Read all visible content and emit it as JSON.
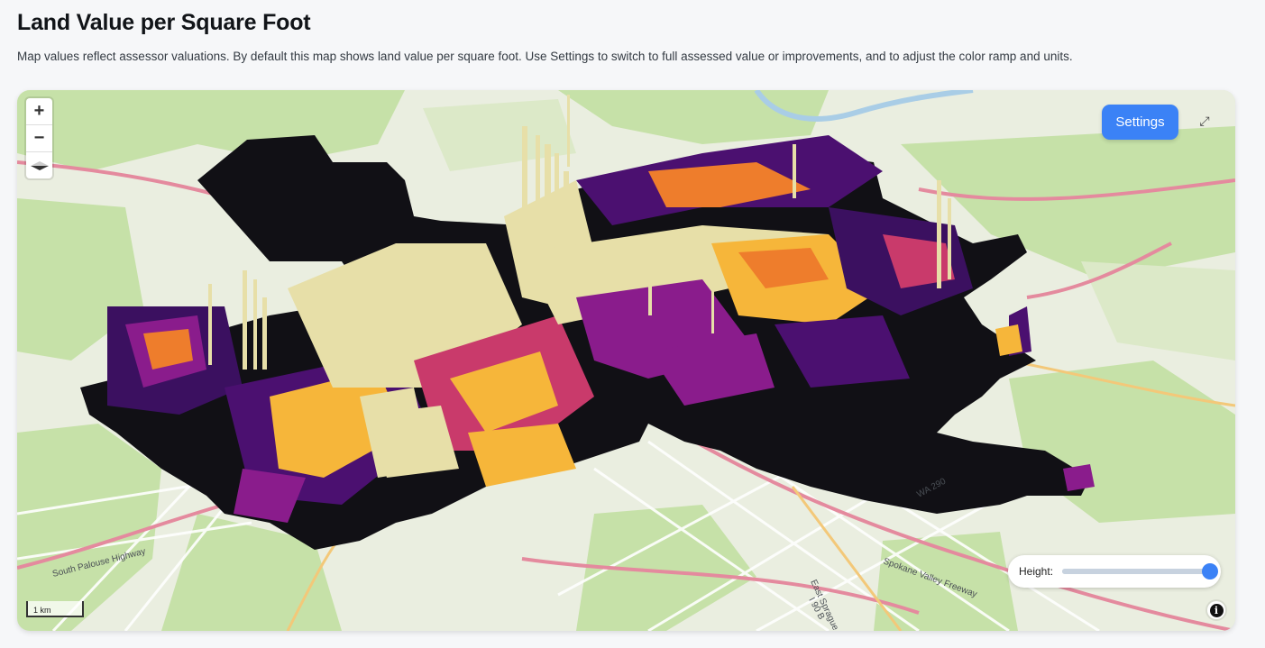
{
  "page": {
    "title": "Land Value per Square Foot",
    "description": "Map values reflect assessor valuations. By default this map shows land value per square foot. Use Settings to switch to full assessed value or improvements, and to adjust the color ramp and units."
  },
  "map": {
    "controls": {
      "zoom_in": "+",
      "zoom_out": "−",
      "settings_label": "Settings",
      "fullscreen_glyph": "⤢",
      "height_label": "Height:",
      "height_value": 1.0,
      "scale_label": "1 km",
      "info_glyph": "i"
    },
    "street_labels": [
      "South Palouse Highway",
      "East Sprague Ave",
      "Spokane Valley Freeway",
      "WA 290",
      "I 90 B"
    ],
    "color_ramp": [
      "#0d0a12",
      "#4b1070",
      "#8a1c8c",
      "#c93a6b",
      "#ee7d2c",
      "#f6b63a",
      "#e7dfa8"
    ],
    "colors": {
      "accent": "#3b82f6",
      "basemap_green": "#c9e3ad",
      "basemap_land": "#eef0e6",
      "road_pink": "#e48a9e",
      "road_white": "#ffffff"
    },
    "icons": [
      "zoom-in-icon",
      "zoom-out-icon",
      "compass-icon",
      "fullscreen-icon",
      "info-icon"
    ]
  }
}
